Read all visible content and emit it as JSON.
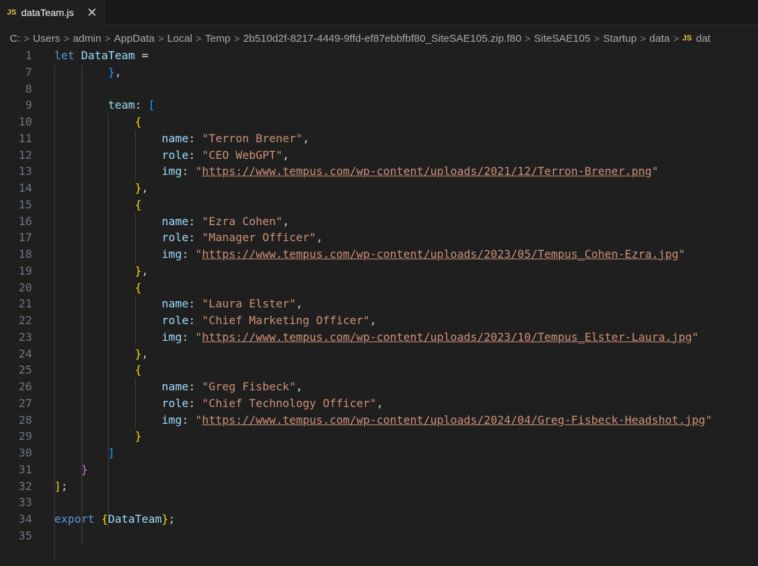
{
  "tab": {
    "icon": "js-file-icon",
    "icon_text": "JS",
    "filename": "dataTeam.js",
    "close_glyph": "✕"
  },
  "breadcrumb": {
    "parts": [
      "C:",
      "Users",
      "admin",
      "AppData",
      "Local",
      "Temp",
      "2b510d2f-8217-4449-9ffd-ef87ebbfbf80_SiteSAE105.zip.f80",
      "SiteSAE105",
      "Startup",
      "data"
    ],
    "file_icon_text": "JS",
    "file": "dat"
  },
  "editor": {
    "lines": [
      {
        "n": "1",
        "tokens": [
          {
            "t": "let ",
            "c": "kw"
          },
          {
            "t": "DataTeam",
            "c": "var"
          },
          {
            "t": " =",
            "c": "plain"
          }
        ]
      },
      {
        "n": "7",
        "tokens": [
          {
            "t": "        ",
            "c": "plain"
          },
          {
            "t": "}",
            "c": "b3"
          },
          {
            "t": ",",
            "c": "plain"
          }
        ]
      },
      {
        "n": "8",
        "tokens": []
      },
      {
        "n": "9",
        "tokens": [
          {
            "t": "        ",
            "c": "plain"
          },
          {
            "t": "team",
            "c": "prop"
          },
          {
            "t": ": ",
            "c": "plain"
          },
          {
            "t": "[",
            "c": "b3"
          }
        ]
      },
      {
        "n": "10",
        "tokens": [
          {
            "t": "            ",
            "c": "plain"
          },
          {
            "t": "{",
            "c": "b1"
          }
        ]
      },
      {
        "n": "11",
        "tokens": [
          {
            "t": "                ",
            "c": "plain"
          },
          {
            "t": "name",
            "c": "prop"
          },
          {
            "t": ": ",
            "c": "plain"
          },
          {
            "t": "\"Terron Brener\"",
            "c": "str"
          },
          {
            "t": ",",
            "c": "plain"
          }
        ]
      },
      {
        "n": "12",
        "tokens": [
          {
            "t": "                ",
            "c": "plain"
          },
          {
            "t": "role",
            "c": "prop"
          },
          {
            "t": ": ",
            "c": "plain"
          },
          {
            "t": "\"CEO WebGPT\"",
            "c": "str"
          },
          {
            "t": ",",
            "c": "plain"
          }
        ]
      },
      {
        "n": "13",
        "tokens": [
          {
            "t": "                ",
            "c": "plain"
          },
          {
            "t": "img",
            "c": "prop"
          },
          {
            "t": ": ",
            "c": "plain"
          },
          {
            "t": "\"",
            "c": "str"
          },
          {
            "t": "https://www.tempus.com/wp-content/uploads/2021/12/Terron-Brener.png",
            "c": "url"
          },
          {
            "t": "\"",
            "c": "str"
          }
        ]
      },
      {
        "n": "14",
        "tokens": [
          {
            "t": "            ",
            "c": "plain"
          },
          {
            "t": "}",
            "c": "b1"
          },
          {
            "t": ",",
            "c": "plain"
          }
        ]
      },
      {
        "n": "15",
        "tokens": [
          {
            "t": "            ",
            "c": "plain"
          },
          {
            "t": "{",
            "c": "b1"
          }
        ]
      },
      {
        "n": "16",
        "tokens": [
          {
            "t": "                ",
            "c": "plain"
          },
          {
            "t": "name",
            "c": "prop"
          },
          {
            "t": ": ",
            "c": "plain"
          },
          {
            "t": "\"Ezra Cohen\"",
            "c": "str"
          },
          {
            "t": ",",
            "c": "plain"
          }
        ]
      },
      {
        "n": "17",
        "tokens": [
          {
            "t": "                ",
            "c": "plain"
          },
          {
            "t": "role",
            "c": "prop"
          },
          {
            "t": ": ",
            "c": "plain"
          },
          {
            "t": "\"Manager Officer\"",
            "c": "str"
          },
          {
            "t": ",",
            "c": "plain"
          }
        ]
      },
      {
        "n": "18",
        "tokens": [
          {
            "t": "                ",
            "c": "plain"
          },
          {
            "t": "img",
            "c": "prop"
          },
          {
            "t": ": ",
            "c": "plain"
          },
          {
            "t": "\"",
            "c": "str"
          },
          {
            "t": "https://www.tempus.com/wp-content/uploads/2023/05/Tempus_Cohen-Ezra.jpg",
            "c": "url"
          },
          {
            "t": "\"",
            "c": "str"
          }
        ]
      },
      {
        "n": "19",
        "tokens": [
          {
            "t": "            ",
            "c": "plain"
          },
          {
            "t": "}",
            "c": "b1"
          },
          {
            "t": ",",
            "c": "plain"
          }
        ]
      },
      {
        "n": "20",
        "tokens": [
          {
            "t": "            ",
            "c": "plain"
          },
          {
            "t": "{",
            "c": "b1"
          }
        ]
      },
      {
        "n": "21",
        "tokens": [
          {
            "t": "                ",
            "c": "plain"
          },
          {
            "t": "name",
            "c": "prop"
          },
          {
            "t": ": ",
            "c": "plain"
          },
          {
            "t": "\"Laura Elster\"",
            "c": "str"
          },
          {
            "t": ",",
            "c": "plain"
          }
        ]
      },
      {
        "n": "22",
        "tokens": [
          {
            "t": "                ",
            "c": "plain"
          },
          {
            "t": "role",
            "c": "prop"
          },
          {
            "t": ": ",
            "c": "plain"
          },
          {
            "t": "\"Chief Marketing Officer\"",
            "c": "str"
          },
          {
            "t": ",",
            "c": "plain"
          }
        ]
      },
      {
        "n": "23",
        "tokens": [
          {
            "t": "                ",
            "c": "plain"
          },
          {
            "t": "img",
            "c": "prop"
          },
          {
            "t": ": ",
            "c": "plain"
          },
          {
            "t": "\"",
            "c": "str"
          },
          {
            "t": "https://www.tempus.com/wp-content/uploads/2023/10/Tempus_Elster-Laura.jpg",
            "c": "url"
          },
          {
            "t": "\"",
            "c": "str"
          }
        ]
      },
      {
        "n": "24",
        "tokens": [
          {
            "t": "            ",
            "c": "plain"
          },
          {
            "t": "}",
            "c": "b1"
          },
          {
            "t": ",",
            "c": "plain"
          }
        ]
      },
      {
        "n": "25",
        "tokens": [
          {
            "t": "            ",
            "c": "plain"
          },
          {
            "t": "{",
            "c": "b1"
          }
        ]
      },
      {
        "n": "26",
        "tokens": [
          {
            "t": "                ",
            "c": "plain"
          },
          {
            "t": "name",
            "c": "prop"
          },
          {
            "t": ": ",
            "c": "plain"
          },
          {
            "t": "\"Greg Fisbeck\"",
            "c": "str"
          },
          {
            "t": ",",
            "c": "plain"
          }
        ]
      },
      {
        "n": "27",
        "tokens": [
          {
            "t": "                ",
            "c": "plain"
          },
          {
            "t": "role",
            "c": "prop"
          },
          {
            "t": ": ",
            "c": "plain"
          },
          {
            "t": "\"Chief Technology Officer\"",
            "c": "str"
          },
          {
            "t": ",",
            "c": "plain"
          }
        ]
      },
      {
        "n": "28",
        "tokens": [
          {
            "t": "                ",
            "c": "plain"
          },
          {
            "t": "img",
            "c": "prop"
          },
          {
            "t": ": ",
            "c": "plain"
          },
          {
            "t": "\"",
            "c": "str"
          },
          {
            "t": "https://www.tempus.com/wp-content/uploads/2024/04/Greg-Fisbeck-Headshot.jpg",
            "c": "url"
          },
          {
            "t": "\"",
            "c": "str"
          }
        ]
      },
      {
        "n": "29",
        "tokens": [
          {
            "t": "            ",
            "c": "plain"
          },
          {
            "t": "}",
            "c": "b1"
          }
        ]
      },
      {
        "n": "30",
        "tokens": [
          {
            "t": "        ",
            "c": "plain"
          },
          {
            "t": "]",
            "c": "b3"
          }
        ]
      },
      {
        "n": "31",
        "tokens": [
          {
            "t": "    ",
            "c": "plain"
          },
          {
            "t": "}",
            "c": "b2"
          }
        ]
      },
      {
        "n": "32",
        "tokens": [
          {
            "t": "]",
            "c": "b1"
          },
          {
            "t": ";",
            "c": "plain"
          }
        ]
      },
      {
        "n": "33",
        "tokens": []
      },
      {
        "n": "34",
        "tokens": [
          {
            "t": "export ",
            "c": "kw"
          },
          {
            "t": "{",
            "c": "b1"
          },
          {
            "t": "DataTeam",
            "c": "var"
          },
          {
            "t": "}",
            "c": "b1"
          },
          {
            "t": ";",
            "c": "plain"
          }
        ]
      },
      {
        "n": "35",
        "tokens": []
      }
    ]
  },
  "colors": {
    "background": "#1f1f1f",
    "keyword": "#569cd6",
    "variable": "#9cdcfe",
    "string": "#ce9178",
    "bracket_gold": "#ffd700",
    "bracket_pink": "#da70d6",
    "bracket_blue": "#179fff",
    "js_icon": "#e8c341"
  }
}
